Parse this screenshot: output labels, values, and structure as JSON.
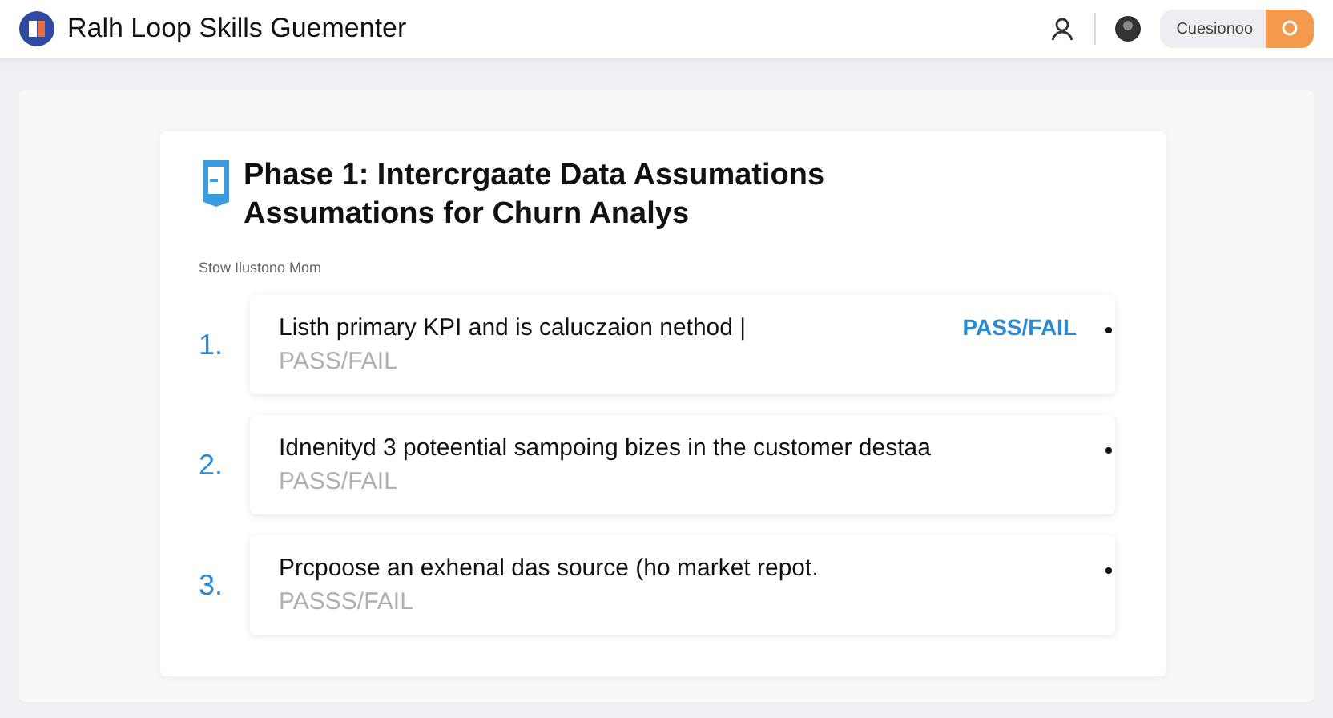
{
  "app": {
    "title": "Ralh Loop Skills Guementer",
    "account_label": "Cuesionoo"
  },
  "phase": {
    "title": "Phase 1: Intercrgaate Data Assumations Assumations for Churn Analys",
    "subtitle": "Stow Ilustono Mom"
  },
  "items": [
    {
      "number": "1.",
      "text": "Listh primary KPI and is caluczaion nethod |",
      "status": "PASS/FAIL",
      "result": "PASS/FAIL"
    },
    {
      "number": "2.",
      "text": "Idnenityd 3 poteential sampoing bizes in the customer destaa",
      "status": "PASS/FAIL"
    },
    {
      "number": "3.",
      "text": "Prcpoose an exhenal das source (ho market repot.",
      "status": "PASSS/FAIL"
    }
  ]
}
